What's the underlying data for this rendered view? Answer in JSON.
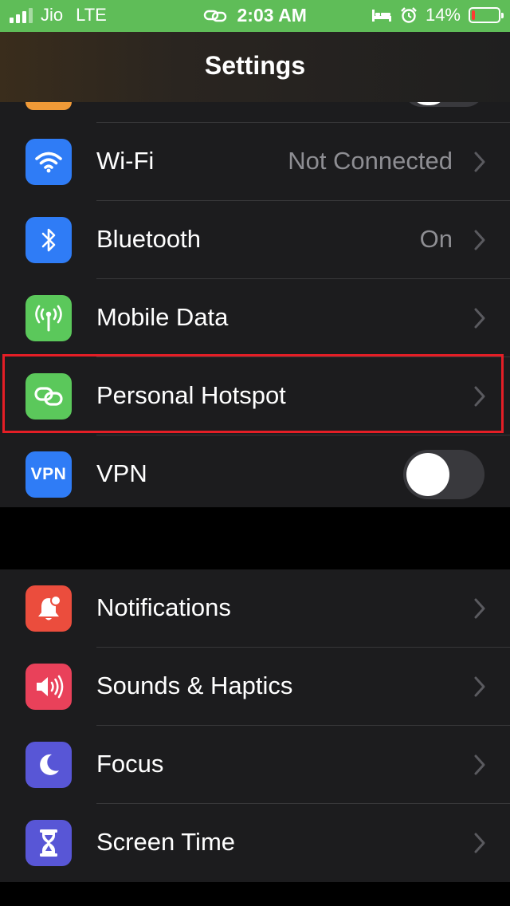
{
  "status_bar": {
    "carrier": "Jio",
    "network": "LTE",
    "time": "2:03 AM",
    "battery": "14%",
    "battery_level": 0.14,
    "background": "#5fbd58"
  },
  "nav": {
    "title": "Settings"
  },
  "connectivity": [
    {
      "id": "wifi",
      "label": "Wi-Fi",
      "value": "Not Connected",
      "icon": "wifi-icon",
      "color": "#2f7cf6"
    },
    {
      "id": "bluetooth",
      "label": "Bluetooth",
      "value": "On",
      "icon": "bluetooth-icon",
      "color": "#2f7cf6"
    },
    {
      "id": "mobile-data",
      "label": "Mobile Data",
      "icon": "antenna-icon",
      "color": "#5bc85b"
    },
    {
      "id": "personal-hotspot",
      "label": "Personal Hotspot",
      "icon": "hotspot-link-icon",
      "color": "#5bc85b",
      "highlighted": true
    },
    {
      "id": "vpn",
      "label": "VPN",
      "icon_text": "VPN",
      "icon": "vpn-icon",
      "color": "#2f7cf6",
      "toggle": false
    }
  ],
  "system": [
    {
      "id": "notifications",
      "label": "Notifications",
      "icon": "bell-icon",
      "color": "#eb4d3d"
    },
    {
      "id": "sounds",
      "label": "Sounds & Haptics",
      "icon": "speaker-icon",
      "color": "#e9415a"
    },
    {
      "id": "focus",
      "label": "Focus",
      "icon": "moon-icon",
      "color": "#5856d6"
    },
    {
      "id": "screen-time",
      "label": "Screen Time",
      "icon": "hourglass-icon",
      "color": "#5856d6"
    }
  ]
}
